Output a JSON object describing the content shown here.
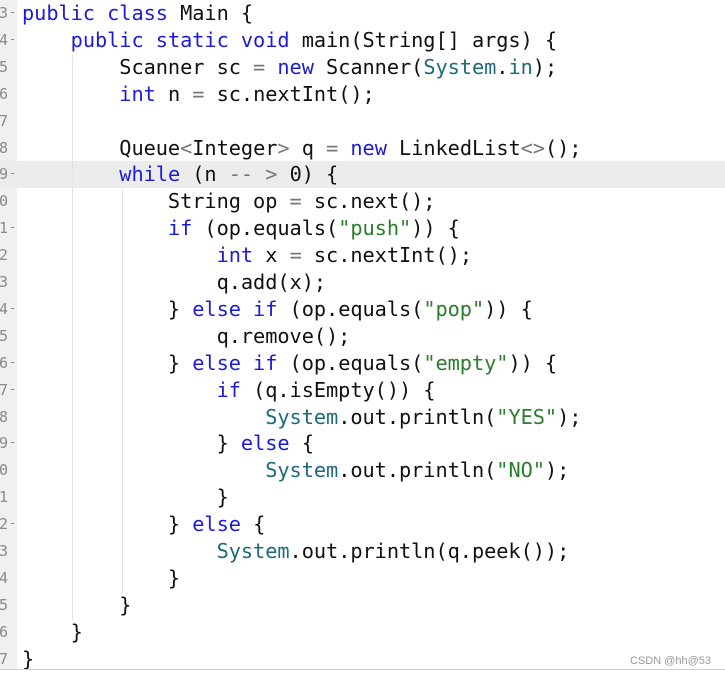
{
  "editor": {
    "highlighted_line": 9,
    "colors": {
      "keyword": "#1c1cd8",
      "string": "#2a7d2a",
      "class": "#1d6a7a",
      "operator": "#777777",
      "highlight": "#ececec"
    },
    "lines": [
      {
        "num": "3",
        "fold": true,
        "tokens": [
          [
            "kw",
            "public class "
          ],
          [
            "",
            "Main {"
          ]
        ]
      },
      {
        "num": "4",
        "fold": true,
        "tokens": [
          [
            "",
            "    "
          ],
          [
            "kw",
            "public static void "
          ],
          [
            "",
            "main(String[] args) {"
          ]
        ]
      },
      {
        "num": "5",
        "fold": false,
        "tokens": [
          [
            "",
            "        Scanner sc "
          ],
          [
            "op",
            "="
          ],
          [
            "kw",
            " new "
          ],
          [
            "",
            "Scanner("
          ],
          [
            "cls",
            "System"
          ],
          [
            "",
            "."
          ],
          [
            "cls",
            "in"
          ],
          [
            "",
            ");"
          ]
        ]
      },
      {
        "num": "6",
        "fold": false,
        "tokens": [
          [
            "",
            "        "
          ],
          [
            "kw",
            "int "
          ],
          [
            "",
            "n "
          ],
          [
            "op",
            "="
          ],
          [
            "",
            " sc.nextInt();"
          ]
        ]
      },
      {
        "num": "7",
        "fold": false,
        "tokens": []
      },
      {
        "num": "8",
        "fold": false,
        "tokens": [
          [
            "",
            "        Queue"
          ],
          [
            "op",
            "<"
          ],
          [
            "",
            "Integer"
          ],
          [
            "op",
            ">"
          ],
          [
            "",
            " q "
          ],
          [
            "op",
            "="
          ],
          [
            "kw",
            " new "
          ],
          [
            "",
            "LinkedList"
          ],
          [
            "op",
            "<>"
          ],
          [
            "",
            "();"
          ]
        ]
      },
      {
        "num": "9",
        "fold": true,
        "tokens": [
          [
            "",
            "        "
          ],
          [
            "kw",
            "while "
          ],
          [
            "",
            "(n "
          ],
          [
            "op",
            "-- >"
          ],
          [
            "",
            " 0) {"
          ]
        ]
      },
      {
        "num": "0",
        "fold": false,
        "tokens": [
          [
            "",
            "            String op "
          ],
          [
            "op",
            "="
          ],
          [
            "",
            " sc.next();"
          ]
        ]
      },
      {
        "num": "1",
        "fold": true,
        "tokens": [
          [
            "",
            "            "
          ],
          [
            "kw",
            "if "
          ],
          [
            "",
            "(op.equals("
          ],
          [
            "str",
            "\"push\""
          ],
          [
            "",
            ")) {"
          ]
        ]
      },
      {
        "num": "2",
        "fold": false,
        "tokens": [
          [
            "",
            "                "
          ],
          [
            "kw",
            "int "
          ],
          [
            "",
            "x "
          ],
          [
            "op",
            "="
          ],
          [
            "",
            " sc.nextInt();"
          ]
        ]
      },
      {
        "num": "3",
        "fold": false,
        "tokens": [
          [
            "",
            "                q.add(x);"
          ]
        ]
      },
      {
        "num": "4",
        "fold": true,
        "tokens": [
          [
            "",
            "            } "
          ],
          [
            "kw",
            "else if "
          ],
          [
            "",
            "(op.equals("
          ],
          [
            "str",
            "\"pop\""
          ],
          [
            "",
            ")) {"
          ]
        ]
      },
      {
        "num": "5",
        "fold": false,
        "tokens": [
          [
            "",
            "                q.remove();"
          ]
        ]
      },
      {
        "num": "6",
        "fold": true,
        "tokens": [
          [
            "",
            "            } "
          ],
          [
            "kw",
            "else if "
          ],
          [
            "",
            "(op.equals("
          ],
          [
            "str",
            "\"empty\""
          ],
          [
            "",
            ")) {"
          ]
        ]
      },
      {
        "num": "7",
        "fold": true,
        "tokens": [
          [
            "",
            "                "
          ],
          [
            "kw",
            "if "
          ],
          [
            "",
            "(q.isEmpty()) {"
          ]
        ]
      },
      {
        "num": "8",
        "fold": false,
        "tokens": [
          [
            "",
            "                    "
          ],
          [
            "cls",
            "System"
          ],
          [
            "",
            ".out.println("
          ],
          [
            "str",
            "\"YES\""
          ],
          [
            "",
            ");"
          ]
        ]
      },
      {
        "num": "9",
        "fold": true,
        "tokens": [
          [
            "",
            "                } "
          ],
          [
            "kw",
            "else "
          ],
          [
            "",
            "{"
          ]
        ]
      },
      {
        "num": "0",
        "fold": false,
        "tokens": [
          [
            "",
            "                    "
          ],
          [
            "cls",
            "System"
          ],
          [
            "",
            ".out.println("
          ],
          [
            "str",
            "\"NO\""
          ],
          [
            "",
            ");"
          ]
        ]
      },
      {
        "num": "1",
        "fold": false,
        "tokens": [
          [
            "",
            "                }"
          ]
        ]
      },
      {
        "num": "2",
        "fold": true,
        "tokens": [
          [
            "",
            "            } "
          ],
          [
            "kw",
            "else "
          ],
          [
            "",
            "{"
          ]
        ]
      },
      {
        "num": "3",
        "fold": false,
        "tokens": [
          [
            "",
            "                "
          ],
          [
            "cls",
            "System"
          ],
          [
            "",
            ".out.println(q.peek());"
          ]
        ]
      },
      {
        "num": "4",
        "fold": false,
        "tokens": [
          [
            "",
            "            }"
          ]
        ]
      },
      {
        "num": "5",
        "fold": false,
        "tokens": [
          [
            "",
            "        }"
          ]
        ]
      },
      {
        "num": "6",
        "fold": false,
        "tokens": [
          [
            "",
            "    }"
          ]
        ]
      },
      {
        "num": "7",
        "fold": false,
        "tokens": [
          [
            "",
            "}"
          ]
        ]
      }
    ]
  },
  "watermark": "CSDN @hh@53"
}
